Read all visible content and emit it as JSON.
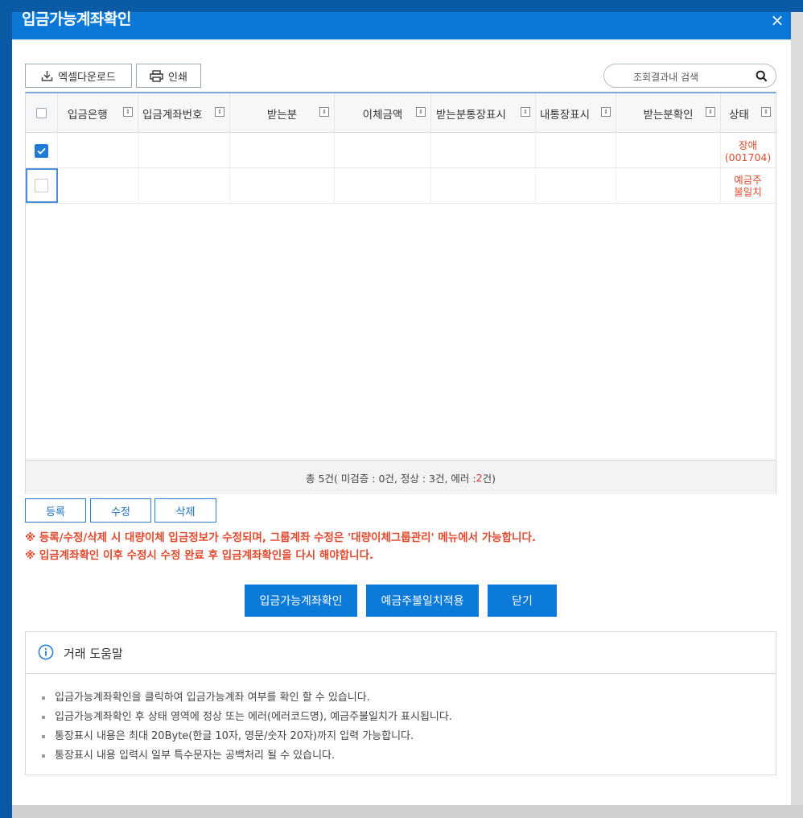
{
  "dialog": {
    "title": "입금가능계좌확인",
    "close_label": "×"
  },
  "toolbar": {
    "excel_label": "엑셀다운로드",
    "print_label": "인쇄",
    "search_placeholder": "조회결과내 검색"
  },
  "grid": {
    "columns": [
      "입금은행",
      "입금계좌번호",
      "받는분",
      "이체금액",
      "받는분통장표시",
      "내통장표시",
      "받는분확인",
      "상태"
    ],
    "rows": [
      {
        "checked": true,
        "status_line1": "장애",
        "status_line2": "(001704)"
      },
      {
        "checked": false,
        "status_line1": "예금주",
        "status_line2": "불일치"
      }
    ],
    "summary_prefix": "총 5건( 미검증 : 0건, 정상 : 3건, 에러 : ",
    "summary_error_count": "2",
    "summary_suffix": "건)"
  },
  "actions": {
    "register": "등록",
    "edit": "수정",
    "delete": "삭제"
  },
  "notices": [
    "※ 등록/수정/삭제 시 대량이체 입금정보가 수정되며, 그룹계좌 수정은 '대량이체그룹관리' 메뉴에서 가능합니다.",
    "※ 입금계좌확인 이후 수정시 수정 완료 후 입금계좌확인을 다시 해야합니다."
  ],
  "main_buttons": {
    "confirm": "입금가능계좌확인",
    "apply_mismatch": "예금주불일치적용",
    "close": "닫기"
  },
  "help": {
    "title": "거래 도움말",
    "items": [
      "입금가능계좌확인을 클릭하여 입금가능계좌 여부를 확인 할 수 있습니다.",
      "입금가능계좌확인 후 상태 영역에 정상 또는 에러(에러코드명), 예금주불일치가 표시됩니다.",
      "통장표시 내용은 최대 20Byte(한글 10자, 영문/숫자 20자)까지 입력 가능합니다.",
      "통장표시 내용 입력시 일부 특수문자는 공백처리 될 수 있습니다."
    ]
  },
  "colors": {
    "title_bar": "#0b78d7",
    "primary_button": "#0b7ad8",
    "error_text": "#e04b2f"
  }
}
